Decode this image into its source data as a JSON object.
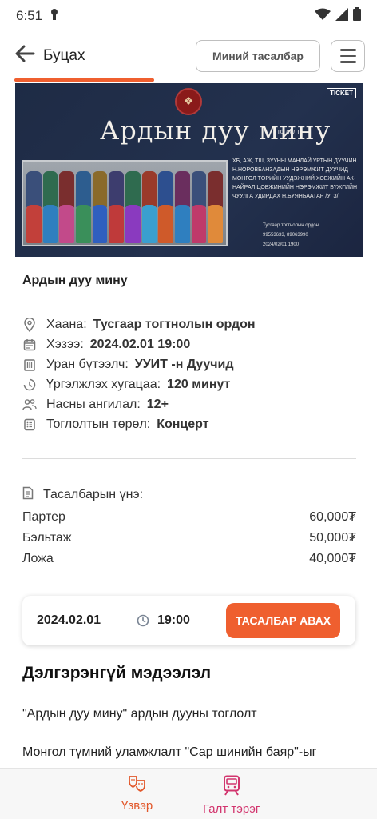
{
  "status_bar": {
    "time": "6:51"
  },
  "header": {
    "back_label": "Буцах",
    "my_tickets_label": "Миний тасалбар"
  },
  "banner": {
    "title": "Ардын дуу мину",
    "subtitle": "тоглолт",
    "ticket_logo": "TICKET",
    "lines": "ХБ, АЖ, ТШ, ЗУУНЫ МАНЛАЙ УРТЫН ДУУЧИН Н.НОРОВБАНЗАДЫН НЭРЭМЖИТ ДУУЧИД  МОНГОЛ ТӨРИЙН УУДЭЖНИЙ ХОЕЖИЙН АК-НАЙРАЛ  ЦОВЖИНИЙН НЭРЭМЖИТ БҮЖГИЙН ЧУУЛГА  УДИРДАХ Н.БУЯНБААТАР /УГЗ/",
    "info": [
      "Тусгаар тогтнолын ордон",
      "99553633, 89063990",
      "2024/02/01 1900"
    ]
  },
  "event": {
    "title": "Ардын дуу мину",
    "venue_label": "Хаана:",
    "venue": "Тусгаар тогтнолын ордон",
    "date_label": "Хэзээ:",
    "date": "2024.02.01 19:00",
    "artist_label": "Уран бүтээлч:",
    "artist": "УУИТ -н Дуучид",
    "duration_label": "Үргэлжлэх хугацаа:",
    "duration": "120 минут",
    "age_label": "Насны ангилал:",
    "age": "12+",
    "type_label": "Тоглолтын төрөл:",
    "type": "Концерт"
  },
  "prices": {
    "heading": "Тасалбарын үнэ:",
    "items": [
      {
        "name": "Партер",
        "price": "60,000₮"
      },
      {
        "name": "Бэльтаж",
        "price": "50,000₮"
      },
      {
        "name": "Ложа",
        "price": "40,000₮"
      }
    ]
  },
  "booking": {
    "date": "2024.02.01",
    "time": "19:00",
    "buy_label": "ТАСАЛБАР АВАХ"
  },
  "details": {
    "title": "Дэлгэрэнгүй мэдээлэл",
    "p1": "\"Ардын дуу мину\" ардын дууны тоглолт",
    "p2": "Монгол түмний уламжлалт \"Сар шинийн баяр\"-ыг"
  },
  "bottom_nav": {
    "shows_label": "Үзвэр",
    "train_label": "Галт тэрэг"
  },
  "colors": {
    "accent": "#ef5f2f",
    "train": "#d2356e",
    "banner_bg": "#1e2b45"
  }
}
